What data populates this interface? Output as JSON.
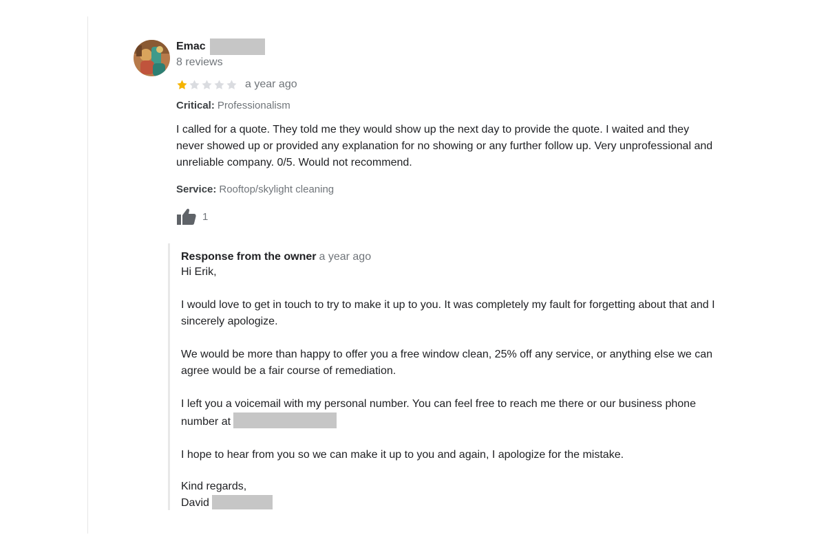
{
  "review": {
    "reviewer_name": "Emac",
    "review_count": "8 reviews",
    "rating": 1,
    "rating_max": 5,
    "time": "a year ago",
    "critical_label": "Critical:",
    "critical_value": "Professionalism",
    "text": "I called for a quote. They told me they would show up the next day to provide the quote. I waited and they never showed up or provided any explanation for no showing or any further follow up. Very unprofessional and unreliable company. 0/5. Would not recommend.",
    "service_label": "Service:",
    "service_value": "Rooftop/skylight cleaning",
    "like_count": "1",
    "icons": {
      "avatar": "avatar",
      "star": "star-icon",
      "like": "thumbs-up-icon"
    },
    "colors": {
      "star_filled": "#f5b400",
      "star_empty": "#dadce0",
      "redaction": "#c6c6c6"
    }
  },
  "owner_response": {
    "label": "Response from the owner",
    "time": "a year ago",
    "greeting": "Hi Erik,",
    "paragraph_1": "I would love to get in touch to try to make it up to you. It was completely my fault for forgetting about that and I sincerely apologize.",
    "paragraph_2": "We would be more than happy to offer you a free window clean, 25% off any service, or anything else we can agree would be a fair course of remediation.",
    "paragraph_3": "I left you a voicemail with my personal number. You can feel free to reach me there or our business phone number at",
    "paragraph_4": "I hope to hear from you so we can make it up to you and again, I apologize for the mistake.",
    "closing": "Kind regards,",
    "signature": "David"
  }
}
